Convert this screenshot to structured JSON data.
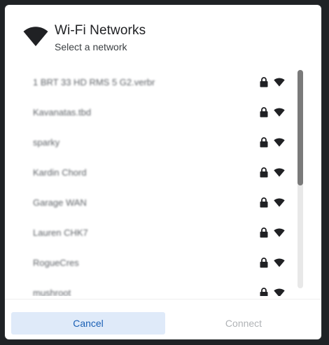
{
  "dialog": {
    "title": "Wi-Fi Networks",
    "subtitle": "Select a network",
    "icon": "wifi-icon"
  },
  "networks": [
    {
      "name": "1 BRT 33 HD RMS 5 G2.verbr",
      "secured": true,
      "signal": "full"
    },
    {
      "name": "Kavanatas.tbd",
      "secured": true,
      "signal": "full"
    },
    {
      "name": "sparky",
      "secured": true,
      "signal": "full"
    },
    {
      "name": "Kardin Chord",
      "secured": true,
      "signal": "full"
    },
    {
      "name": "Garage WAN",
      "secured": true,
      "signal": "full"
    },
    {
      "name": "Lauren CHK7",
      "secured": true,
      "signal": "full"
    },
    {
      "name": "RogueCres",
      "secured": true,
      "signal": "full"
    },
    {
      "name": "mushroot",
      "secured": true,
      "signal": "full"
    }
  ],
  "buttons": {
    "cancel": "Cancel",
    "connect": "Connect"
  },
  "colors": {
    "accent": "#1a5fb4",
    "cancel_bg": "#dfeaf9",
    "disabled_text": "#b0b3b6"
  }
}
